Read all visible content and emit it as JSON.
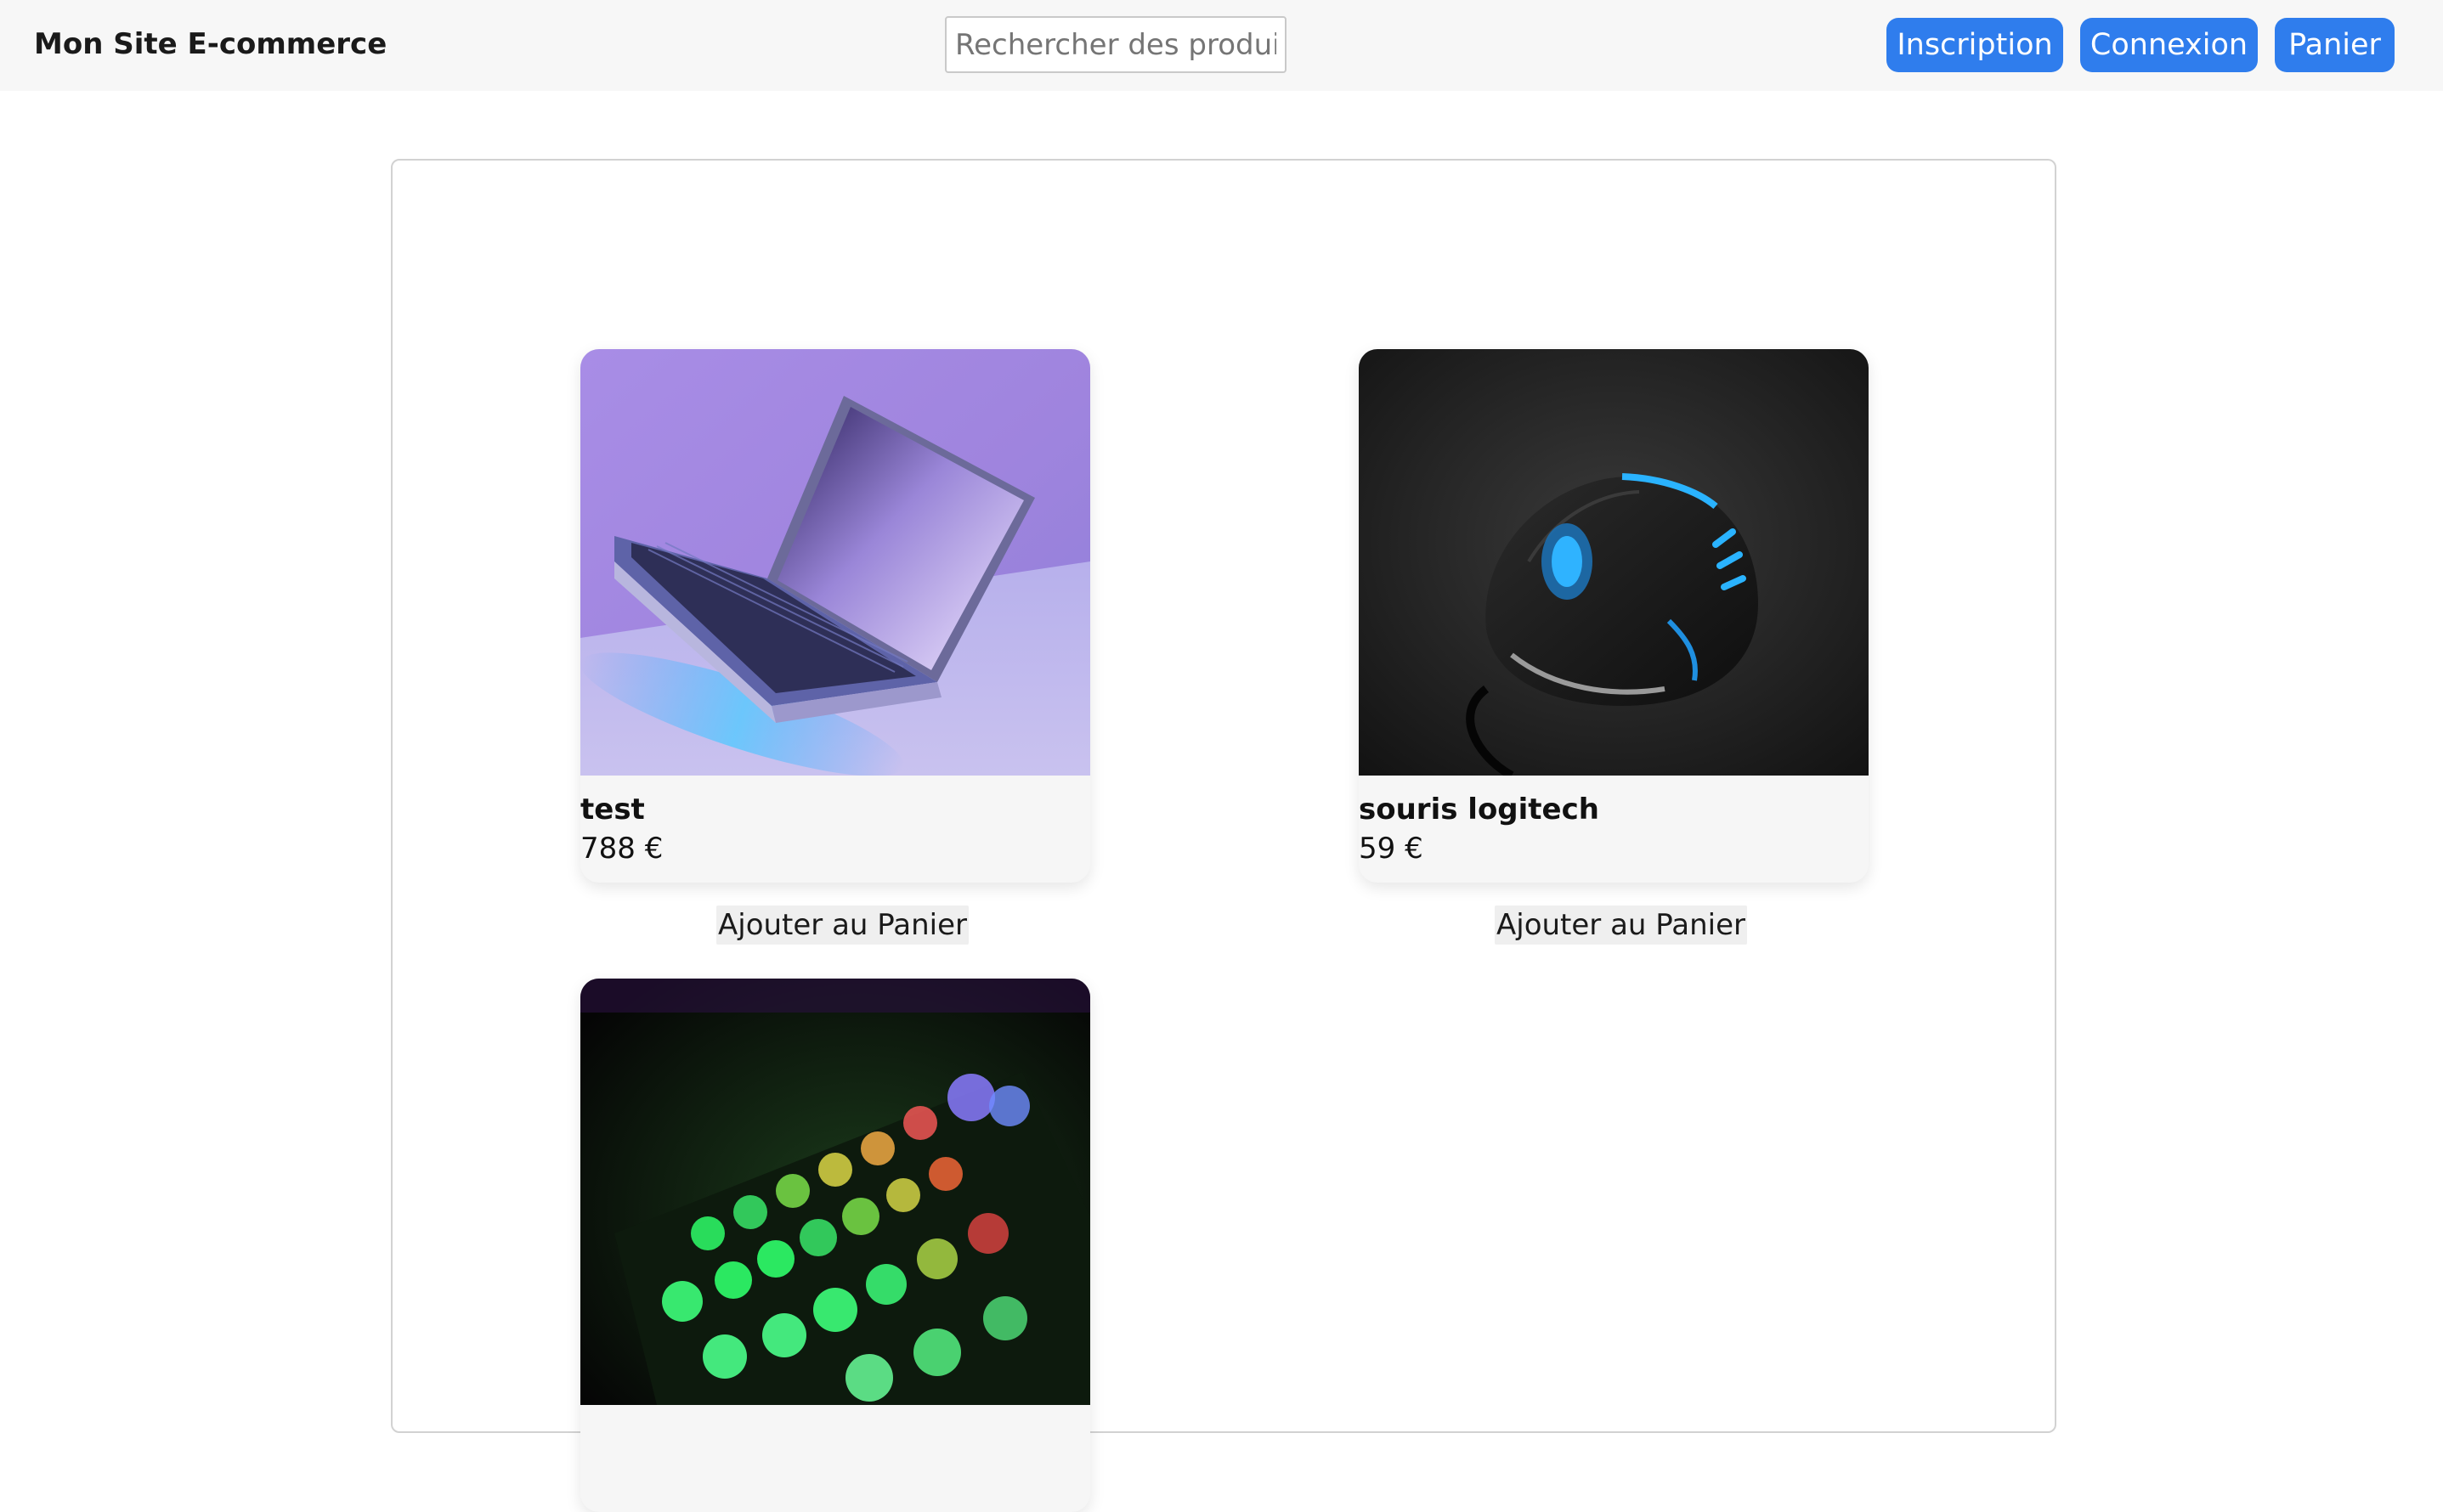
{
  "header": {
    "brand": "Mon Site E-commerce",
    "search_placeholder": "Rechercher des produits",
    "nav": {
      "inscription": "Inscription",
      "connexion": "Connexion",
      "panier": "Panier"
    }
  },
  "products": [
    {
      "name": "test",
      "price": "788 €",
      "add_label": "Ajouter au Panier",
      "image": "laptop-image"
    },
    {
      "name": "souris logitech",
      "price": "59 €",
      "add_label": "Ajouter au Panier",
      "image": "mouse-image"
    },
    {
      "image": "keyboard-image"
    }
  ],
  "colors": {
    "accent": "#2f7ded",
    "topbar_bg": "#f7f7f7",
    "card_bg": "#f6f6f6"
  }
}
